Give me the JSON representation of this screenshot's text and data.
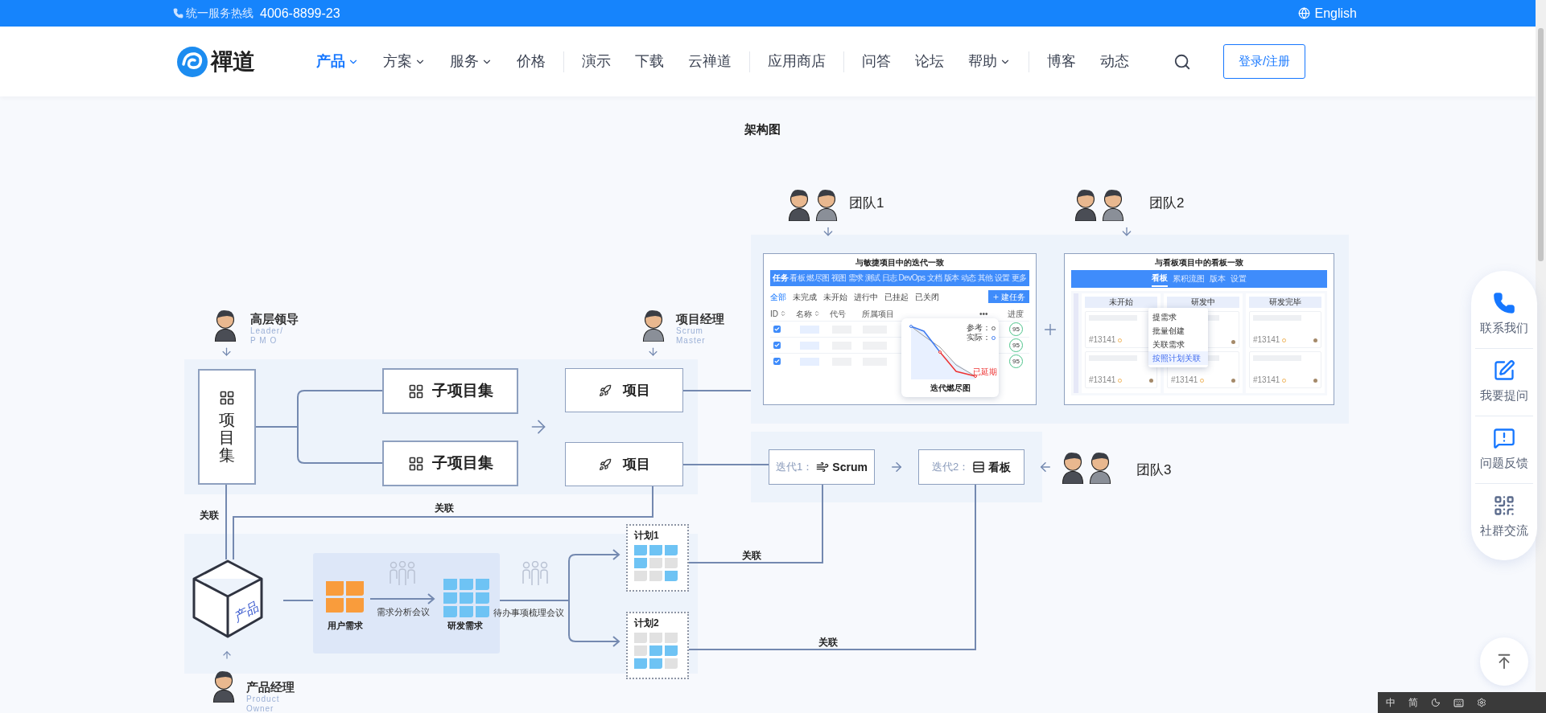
{
  "top_bar": {
    "hotline_label": "统一服务热线",
    "hotline_number": "4006-8899-23",
    "language": "English"
  },
  "nav": {
    "logo": "禪道",
    "groups": [
      [
        {
          "label": "产品",
          "selected": true,
          "has_menu": true
        },
        {
          "label": "方案",
          "selected": false,
          "has_menu": true
        },
        {
          "label": "服务",
          "selected": false,
          "has_menu": true
        },
        {
          "label": "价格",
          "selected": false,
          "has_menu": false
        }
      ],
      [
        {
          "label": "演示",
          "selected": false,
          "has_menu": false
        },
        {
          "label": "下载",
          "selected": false,
          "has_menu": false
        },
        {
          "label": "云禅道",
          "selected": false,
          "has_menu": false
        }
      ],
      [
        {
          "label": "应用商店",
          "selected": false,
          "has_menu": false
        }
      ],
      [
        {
          "label": "问答",
          "selected": false,
          "has_menu": false
        },
        {
          "label": "论坛",
          "selected": false,
          "has_menu": false
        },
        {
          "label": "帮助",
          "selected": false,
          "has_menu": true
        }
      ],
      [
        {
          "label": "博客",
          "selected": false,
          "has_menu": false
        },
        {
          "label": "动态",
          "selected": false,
          "has_menu": false
        }
      ]
    ],
    "login": "登录/注册"
  },
  "diagram": {
    "title": "架构图",
    "teams": [
      "团队1",
      "团队2",
      "团队3"
    ],
    "roles": [
      {
        "title": "高层领导",
        "subtitle": [
          "Leader/",
          "P M O"
        ]
      },
      {
        "title": "项目经理",
        "subtitle": [
          "Scrum",
          "Master"
        ]
      },
      {
        "title": "产品经理",
        "subtitle": [
          "Product",
          "Owner"
        ]
      }
    ],
    "program": "项目集",
    "sub_programs": [
      "子项目集",
      "子项目集"
    ],
    "projects": [
      "项目",
      "项目"
    ],
    "iterations": [
      {
        "prefix": "迭代1：",
        "method": "Scrum",
        "kind": "scrum"
      },
      {
        "prefix": "迭代2：",
        "method": "看板",
        "kind": "kanban"
      }
    ],
    "links": [
      "关联",
      "关联",
      "关联",
      "关联"
    ],
    "product": "产品",
    "backlog": {
      "user_needs": "用户需求",
      "analysis_meeting": "需求分析会议",
      "dev_needs": "研发需求",
      "grooming_meeting": "待办事项梳理会议"
    },
    "plans": [
      "计划1",
      "计划2"
    ],
    "iteration_view": {
      "title": "与敏捷项目中的迭代一致",
      "tabs": [
        {
          "label": "任务",
          "selected": true
        },
        {
          "label": "看板",
          "selected": false
        },
        {
          "label": "燃尽图",
          "selected": false
        },
        {
          "label": "视图",
          "selected": false
        },
        {
          "label": "需求",
          "selected": false
        },
        {
          "label": "测试",
          "selected": false
        },
        {
          "label": "日志",
          "selected": false
        },
        {
          "label": "DevOps",
          "selected": false
        },
        {
          "label": "文档",
          "selected": false
        },
        {
          "label": "版本",
          "selected": false
        },
        {
          "label": "动态",
          "selected": false
        },
        {
          "label": "其他",
          "selected": false
        },
        {
          "label": "设置",
          "selected": false
        },
        {
          "label": "更多",
          "selected": false
        }
      ],
      "filters": [
        {
          "label": "全部",
          "selected": true
        },
        {
          "label": "未完成",
          "selected": false
        },
        {
          "label": "未开始",
          "selected": false
        },
        {
          "label": "进行中",
          "selected": false
        },
        {
          "label": "已挂起",
          "selected": false
        },
        {
          "label": "已关闭",
          "selected": false
        }
      ],
      "create_button": "建任务",
      "columns": [
        "ID",
        "名称",
        "代号",
        "所属项目",
        "•••",
        "进度"
      ],
      "rows": [
        {
          "checked": true,
          "progress": "95"
        },
        {
          "checked": true,
          "progress": "95"
        },
        {
          "checked": true,
          "progress": "95"
        }
      ],
      "burndown": {
        "legend": [
          "参考：",
          "实际："
        ],
        "tag": "已延期",
        "caption": "迭代燃尽图"
      }
    },
    "kanban_view": {
      "title": "与看板项目中的看板一致",
      "tabs": [
        {
          "label": "看板",
          "selected": true
        },
        {
          "label": "累积流图",
          "selected": false
        },
        {
          "label": "版本",
          "selected": false
        },
        {
          "label": "设置",
          "selected": false
        }
      ],
      "columns": [
        {
          "name": "未开始",
          "cards": [
            {
              "kind": "task",
              "id": "#13141"
            },
            {
              "kind": "task",
              "id": "#13141"
            }
          ]
        },
        {
          "name": "研发中",
          "cards": [
            {
              "kind": "task"
            },
            {
              "kind": "task",
              "id": "#13141"
            }
          ]
        },
        {
          "name": "研发完毕",
          "cards": [
            {
              "kind": "task",
              "id": "#13141"
            },
            {
              "kind": "task",
              "id": "#13141"
            }
          ]
        }
      ],
      "menu": [
        {
          "label": "提需求",
          "selected": false
        },
        {
          "label": "批量创建",
          "selected": false
        },
        {
          "label": "关联需求",
          "selected": false
        },
        {
          "label": "按照计划关联",
          "selected": true
        }
      ]
    }
  },
  "sidebar": [
    {
      "label": "联系我们",
      "kind": "phone"
    },
    {
      "label": "我要提问",
      "kind": "question"
    },
    {
      "label": "问题反馈",
      "kind": "feedback"
    },
    {
      "label": "社群交流",
      "kind": "community"
    }
  ],
  "ime_bar": [
    "中",
    "简"
  ]
}
